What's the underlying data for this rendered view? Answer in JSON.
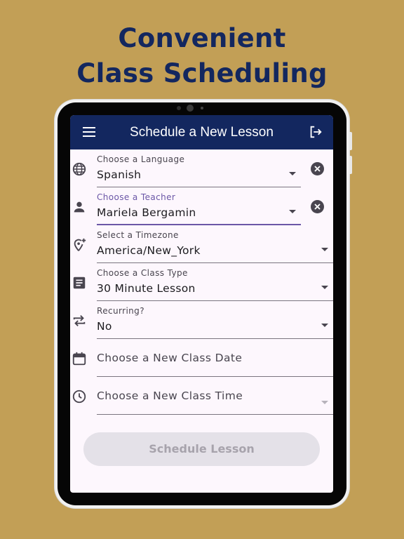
{
  "headline": {
    "line1": "Convenient",
    "line2": "Class Scheduling"
  },
  "appbar": {
    "title": "Schedule a New Lesson",
    "menu_icon": "menu-icon",
    "logout_icon": "logout-icon"
  },
  "fields": {
    "language": {
      "label": "Choose a Language",
      "value": "Spanish",
      "icon": "globe-icon"
    },
    "teacher": {
      "label": "Choose a Teacher",
      "value": "Mariela Bergamin",
      "icon": "person-icon"
    },
    "timezone": {
      "label": "Select a Timezone",
      "value": "America/New_York",
      "icon": "location-add-icon"
    },
    "class_type": {
      "label": "Choose a Class Type",
      "value": "30 Minute Lesson",
      "icon": "article-icon"
    },
    "recurring": {
      "label": "Recurring?",
      "value": "No",
      "icon": "repeat-icon"
    },
    "date": {
      "placeholder": "Choose a New Class Date",
      "icon": "calendar-icon"
    },
    "time": {
      "placeholder": "Choose a New Class Time",
      "icon": "clock-icon"
    }
  },
  "submit": {
    "label": "Schedule Lesson"
  },
  "colors": {
    "background": "#c29f56",
    "brand_navy": "#13275f",
    "accent_purple": "#6b57a7",
    "screen_bg": "#fdf7fd"
  }
}
